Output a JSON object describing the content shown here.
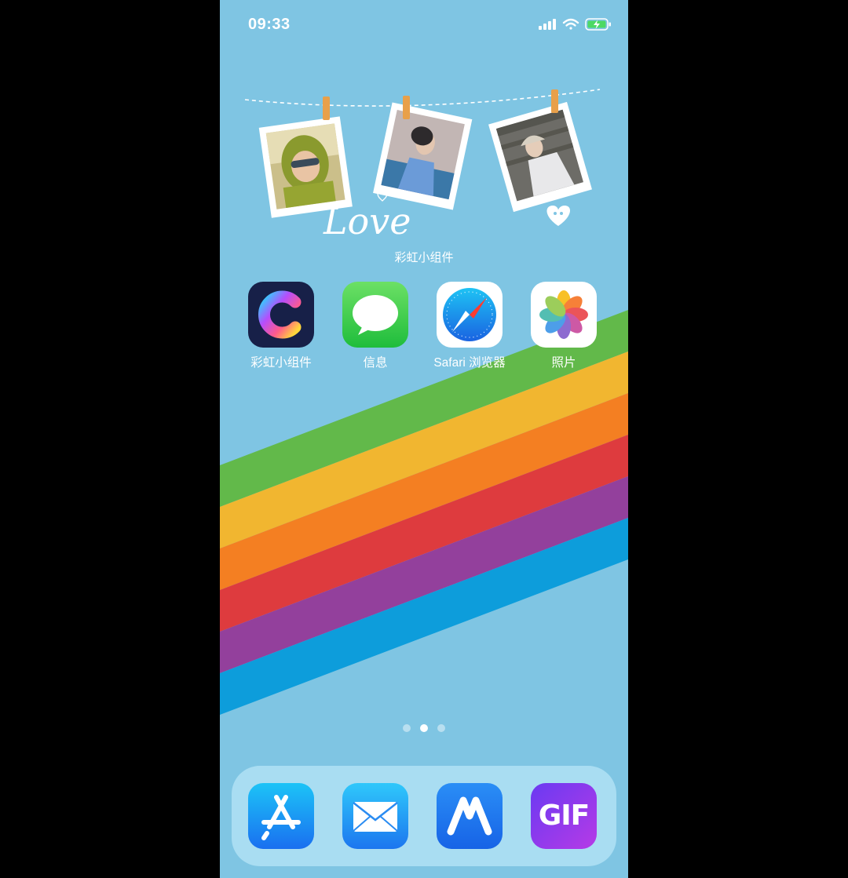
{
  "status_bar": {
    "time": "09:33",
    "icons": [
      "cellular-signal-icon",
      "wifi-icon",
      "battery-charging-icon"
    ]
  },
  "widget": {
    "script_text": "Love",
    "label": "彩虹小组件"
  },
  "apps": [
    {
      "label": "彩虹小组件",
      "icon": "rainbow-widget-app-icon"
    },
    {
      "label": "信息",
      "icon": "messages-app-icon"
    },
    {
      "label": "Safari 浏览器",
      "icon": "safari-app-icon"
    },
    {
      "label": "照片",
      "icon": "photos-app-icon"
    }
  ],
  "page_indicator": {
    "pages": 3,
    "current": 2
  },
  "dock": [
    {
      "icon": "app-store-icon"
    },
    {
      "icon": "mail-app-icon"
    },
    {
      "icon": "m-app-icon"
    },
    {
      "icon": "gif-app-icon",
      "text": "GIF"
    }
  ],
  "colors": {
    "wallpaper": "#7fc5e3",
    "rainbow": [
      "#62b94a",
      "#f1b630",
      "#f47f22",
      "#de3b3e",
      "#93409c",
      "#0d9ddb"
    ]
  }
}
